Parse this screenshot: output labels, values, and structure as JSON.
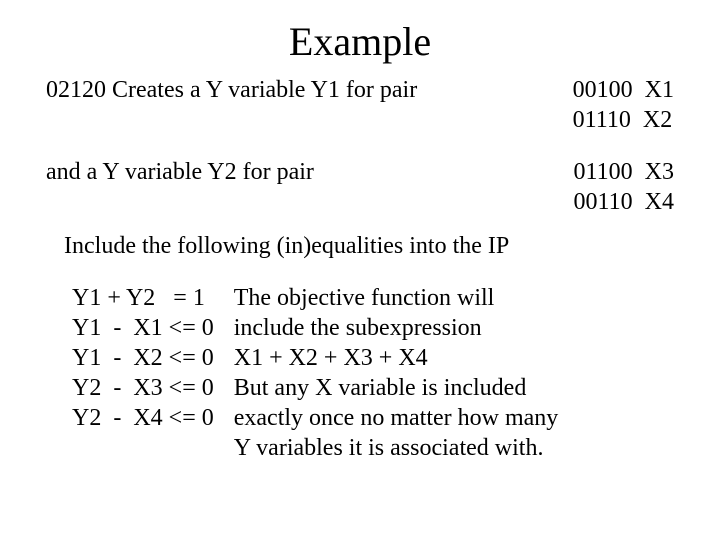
{
  "title": "Example",
  "line1_left": "02120 Creates a Y variable Y1 for pair",
  "pair1_a": "00100  X1",
  "pair1_b": "01110  X2",
  "line2_left": "and a Y variable Y2 for pair",
  "pair2_a": "01100  X3",
  "pair2_b": "00110  X4",
  "include": "Include the following (in)equalities into the IP",
  "eq1": "Y1 + Y2   = 1",
  "eq2": "Y1  -  X1 <= 0",
  "eq3": "Y1  -  X2 <= 0",
  "eq4": "Y2  -  X3 <= 0",
  "eq5": "Y2  -  X4 <= 0",
  "obj1": "The objective function will",
  "obj2": "include the subexpression",
  "obj3": "X1 + X2 + X3 + X4",
  "obj4": "But any X variable is included",
  "obj5": "exactly once no matter how many",
  "obj6": "Y variables it is associated with."
}
